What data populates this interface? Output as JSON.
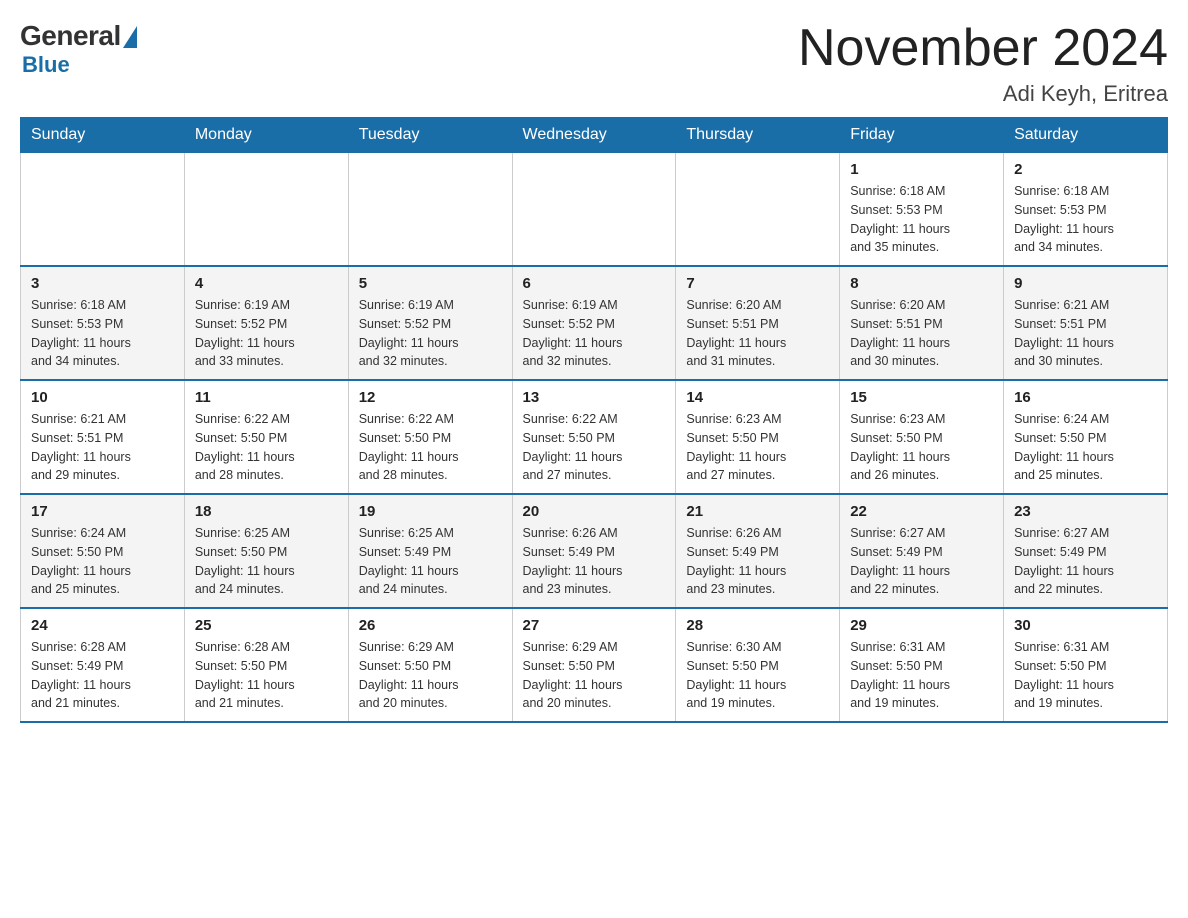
{
  "logo": {
    "general": "General",
    "blue": "Blue"
  },
  "title": {
    "month_year": "November 2024",
    "location": "Adi Keyh, Eritrea"
  },
  "weekdays": [
    "Sunday",
    "Monday",
    "Tuesday",
    "Wednesday",
    "Thursday",
    "Friday",
    "Saturday"
  ],
  "weeks": [
    [
      {
        "day": "",
        "info": ""
      },
      {
        "day": "",
        "info": ""
      },
      {
        "day": "",
        "info": ""
      },
      {
        "day": "",
        "info": ""
      },
      {
        "day": "",
        "info": ""
      },
      {
        "day": "1",
        "info": "Sunrise: 6:18 AM\nSunset: 5:53 PM\nDaylight: 11 hours\nand 35 minutes."
      },
      {
        "day": "2",
        "info": "Sunrise: 6:18 AM\nSunset: 5:53 PM\nDaylight: 11 hours\nand 34 minutes."
      }
    ],
    [
      {
        "day": "3",
        "info": "Sunrise: 6:18 AM\nSunset: 5:53 PM\nDaylight: 11 hours\nand 34 minutes."
      },
      {
        "day": "4",
        "info": "Sunrise: 6:19 AM\nSunset: 5:52 PM\nDaylight: 11 hours\nand 33 minutes."
      },
      {
        "day": "5",
        "info": "Sunrise: 6:19 AM\nSunset: 5:52 PM\nDaylight: 11 hours\nand 32 minutes."
      },
      {
        "day": "6",
        "info": "Sunrise: 6:19 AM\nSunset: 5:52 PM\nDaylight: 11 hours\nand 32 minutes."
      },
      {
        "day": "7",
        "info": "Sunrise: 6:20 AM\nSunset: 5:51 PM\nDaylight: 11 hours\nand 31 minutes."
      },
      {
        "day": "8",
        "info": "Sunrise: 6:20 AM\nSunset: 5:51 PM\nDaylight: 11 hours\nand 30 minutes."
      },
      {
        "day": "9",
        "info": "Sunrise: 6:21 AM\nSunset: 5:51 PM\nDaylight: 11 hours\nand 30 minutes."
      }
    ],
    [
      {
        "day": "10",
        "info": "Sunrise: 6:21 AM\nSunset: 5:51 PM\nDaylight: 11 hours\nand 29 minutes."
      },
      {
        "day": "11",
        "info": "Sunrise: 6:22 AM\nSunset: 5:50 PM\nDaylight: 11 hours\nand 28 minutes."
      },
      {
        "day": "12",
        "info": "Sunrise: 6:22 AM\nSunset: 5:50 PM\nDaylight: 11 hours\nand 28 minutes."
      },
      {
        "day": "13",
        "info": "Sunrise: 6:22 AM\nSunset: 5:50 PM\nDaylight: 11 hours\nand 27 minutes."
      },
      {
        "day": "14",
        "info": "Sunrise: 6:23 AM\nSunset: 5:50 PM\nDaylight: 11 hours\nand 27 minutes."
      },
      {
        "day": "15",
        "info": "Sunrise: 6:23 AM\nSunset: 5:50 PM\nDaylight: 11 hours\nand 26 minutes."
      },
      {
        "day": "16",
        "info": "Sunrise: 6:24 AM\nSunset: 5:50 PM\nDaylight: 11 hours\nand 25 minutes."
      }
    ],
    [
      {
        "day": "17",
        "info": "Sunrise: 6:24 AM\nSunset: 5:50 PM\nDaylight: 11 hours\nand 25 minutes."
      },
      {
        "day": "18",
        "info": "Sunrise: 6:25 AM\nSunset: 5:50 PM\nDaylight: 11 hours\nand 24 minutes."
      },
      {
        "day": "19",
        "info": "Sunrise: 6:25 AM\nSunset: 5:49 PM\nDaylight: 11 hours\nand 24 minutes."
      },
      {
        "day": "20",
        "info": "Sunrise: 6:26 AM\nSunset: 5:49 PM\nDaylight: 11 hours\nand 23 minutes."
      },
      {
        "day": "21",
        "info": "Sunrise: 6:26 AM\nSunset: 5:49 PM\nDaylight: 11 hours\nand 23 minutes."
      },
      {
        "day": "22",
        "info": "Sunrise: 6:27 AM\nSunset: 5:49 PM\nDaylight: 11 hours\nand 22 minutes."
      },
      {
        "day": "23",
        "info": "Sunrise: 6:27 AM\nSunset: 5:49 PM\nDaylight: 11 hours\nand 22 minutes."
      }
    ],
    [
      {
        "day": "24",
        "info": "Sunrise: 6:28 AM\nSunset: 5:49 PM\nDaylight: 11 hours\nand 21 minutes."
      },
      {
        "day": "25",
        "info": "Sunrise: 6:28 AM\nSunset: 5:50 PM\nDaylight: 11 hours\nand 21 minutes."
      },
      {
        "day": "26",
        "info": "Sunrise: 6:29 AM\nSunset: 5:50 PM\nDaylight: 11 hours\nand 20 minutes."
      },
      {
        "day": "27",
        "info": "Sunrise: 6:29 AM\nSunset: 5:50 PM\nDaylight: 11 hours\nand 20 minutes."
      },
      {
        "day": "28",
        "info": "Sunrise: 6:30 AM\nSunset: 5:50 PM\nDaylight: 11 hours\nand 19 minutes."
      },
      {
        "day": "29",
        "info": "Sunrise: 6:31 AM\nSunset: 5:50 PM\nDaylight: 11 hours\nand 19 minutes."
      },
      {
        "day": "30",
        "info": "Sunrise: 6:31 AM\nSunset: 5:50 PM\nDaylight: 11 hours\nand 19 minutes."
      }
    ]
  ]
}
